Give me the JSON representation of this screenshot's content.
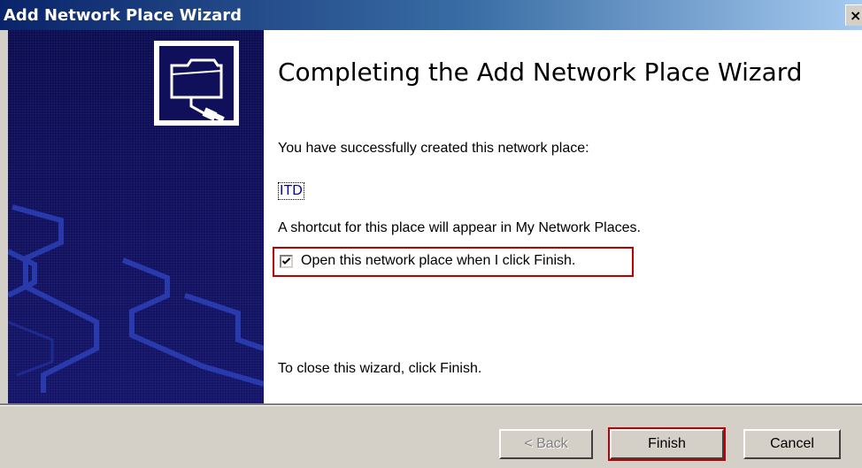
{
  "window": {
    "title": "Add Network Place Wizard",
    "close_label": "×"
  },
  "content": {
    "heading": "Completing the Add Network Place Wizard",
    "success_text": "You have successfully created this network place:",
    "place_name": "ITD",
    "shortcut_text": "A shortcut for this place will appear in My Network Places.",
    "open_checkbox": {
      "label": "Open this network place when I click Finish.",
      "checked": true
    },
    "close_instruction": "To close this wizard, click Finish."
  },
  "buttons": {
    "back_label": "< Back",
    "finish_label": "Finish",
    "cancel_label": "Cancel"
  },
  "icons": {
    "banner_icon": "network-folder-icon",
    "checkbox_mark": "checkmark-icon"
  },
  "colors": {
    "title_gradient_start": "#0a246a",
    "banner_background": "#10105a",
    "highlight_border": "#c00000",
    "dialog_face": "#d4d0c8",
    "link": "#0000aa"
  }
}
